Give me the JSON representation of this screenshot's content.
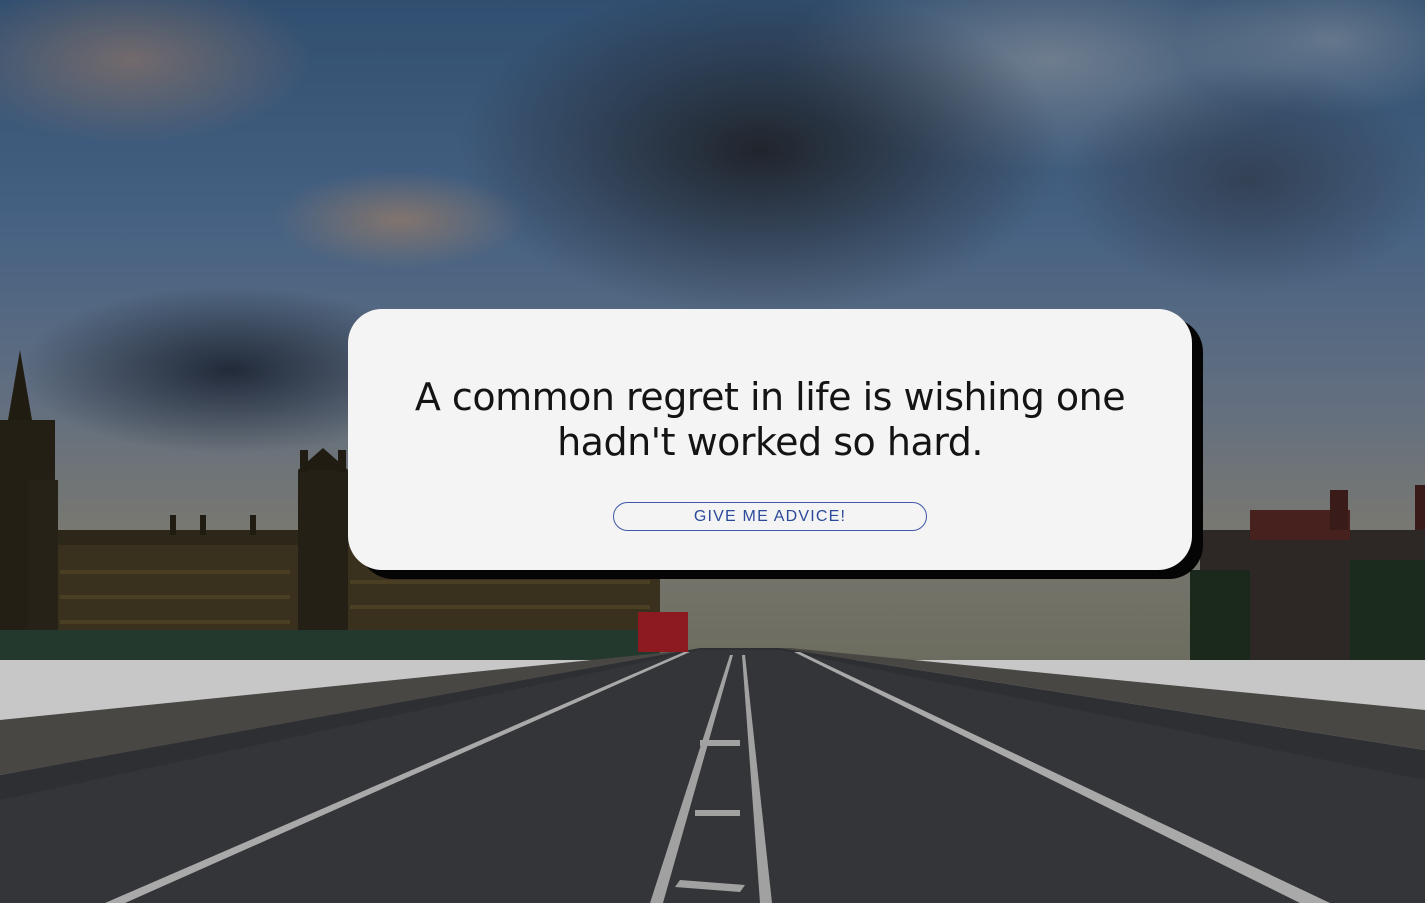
{
  "advice": {
    "text": "A common regret in life is wishing one hadn't worked so hard."
  },
  "button": {
    "label": "GIVE ME ADVICE!"
  },
  "colors": {
    "card_background": "#f4f4f4",
    "card_shadow": "#050505",
    "button_border": "#3f58a8",
    "button_text": "#2c4a9a",
    "text": "#141414"
  }
}
